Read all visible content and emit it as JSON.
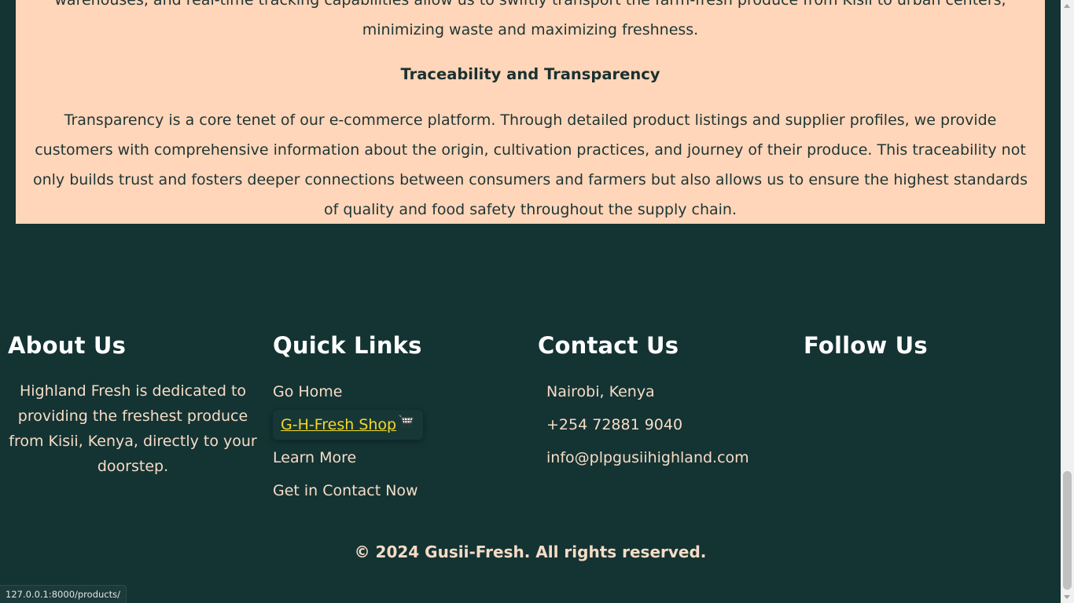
{
  "article": {
    "paragraph1": "warehouses, and real-time tracking capabilities allow us to swiftly transport the farm-fresh produce from Kisii to urban centers, minimizing waste and maximizing freshness.",
    "heading": "Traceability and Transparency",
    "paragraph2": "Transparency is a core tenet of our e-commerce platform. Through detailed product listings and supplier profiles, we provide customers with comprehensive information about the origin, cultivation practices, and journey of their produce. This traceability not only builds trust and fosters deeper connections between consumers and farmers but also allows us to ensure the highest standards of quality and food safety throughout the supply chain."
  },
  "footer": {
    "about": {
      "title": "About Us",
      "text": "Highland Fresh is dedicated to providing the freshest produce from Kisii, Kenya, directly to your doorstep."
    },
    "quick_links": {
      "title": "Quick Links",
      "items": [
        {
          "label": "Go Home"
        },
        {
          "label": "G-H-Fresh Shop",
          "icon": "shopping-cart-icon"
        },
        {
          "label": "Learn More"
        },
        {
          "label": "Get in Contact Now"
        }
      ]
    },
    "contact": {
      "title": "Contact Us",
      "location": "Nairobi, Kenya",
      "phone": "+254 72881 9040",
      "email": "info@plpgusiihighland.com"
    },
    "follow": {
      "title": "Follow Us"
    },
    "copyright": "© 2024 Gusii-Fresh. All rights reserved."
  },
  "status_bar": {
    "url": "127.0.0.1:8000/products/"
  },
  "colors": {
    "background": "#143333",
    "article_background": "#ffd6b9",
    "footer_text": "#f6dcc6",
    "active_link": "#f3d82a"
  }
}
